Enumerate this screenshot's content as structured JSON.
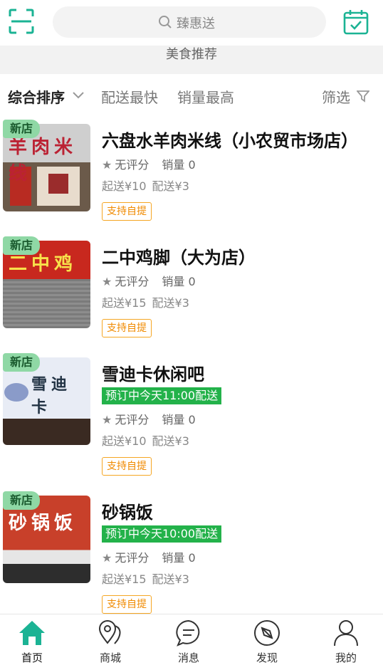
{
  "header": {
    "search_placeholder": "臻惠送"
  },
  "section_title": "美食推荐",
  "sort": {
    "comprehensive": "综合排序",
    "fastest": "配送最快",
    "top_sales": "销量最高",
    "filter": "筛选"
  },
  "shops": [
    {
      "new_tag": "新店",
      "name": "六盘水羊肉米线（小农贸市场店）",
      "preorder": "",
      "rating": "无评分",
      "sales": "销量 0",
      "min_order": "起送¥10",
      "delivery_fee": "配送¥3",
      "self_pickup": "支持自提",
      "sign_text": "羊肉米线",
      "sign_color": "#d8d8d8"
    },
    {
      "new_tag": "新店",
      "name": "二中鸡脚（大为店）",
      "preorder": "",
      "rating": "无评分",
      "sales": "销量 0",
      "min_order": "起送¥15",
      "delivery_fee": "配送¥3",
      "self_pickup": "支持自提",
      "sign_text": "二中鸡",
      "sign_color": "#c8281e"
    },
    {
      "new_tag": "新店",
      "name": "雪迪卡休闲吧",
      "preorder": "预订中今天11:00配送",
      "rating": "无评分",
      "sales": "销量 0",
      "min_order": "起送¥10",
      "delivery_fee": "配送¥3",
      "self_pickup": "支持自提",
      "sign_text": "雪迪卡",
      "sign_color": "#e8ecf5"
    },
    {
      "new_tag": "新店",
      "name": "砂锅饭",
      "preorder": "预订中今天10:00配送",
      "rating": "无评分",
      "sales": "销量 0",
      "min_order": "起送¥15",
      "delivery_fee": "配送¥3",
      "self_pickup": "支持自提",
      "sign_text": "砂锅饭",
      "sign_color": "#c8402a"
    }
  ],
  "tabs": [
    {
      "label": "首页"
    },
    {
      "label": "商城"
    },
    {
      "label": "消息"
    },
    {
      "label": "发现"
    },
    {
      "label": "我的"
    }
  ],
  "colors": {
    "accent": "#1bb394",
    "preorder": "#23b24a",
    "pickup": "#f5a623"
  }
}
